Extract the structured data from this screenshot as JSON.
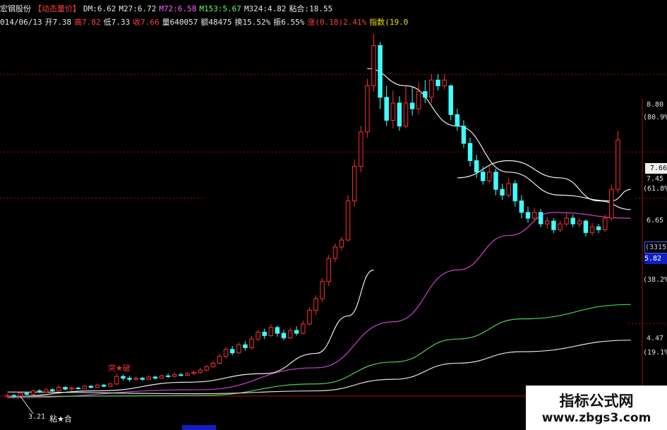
{
  "header": {
    "row1": [
      {
        "text": "宏钢股份",
        "cls": "w"
      },
      {
        "text": "【动态量价】",
        "cls": "r"
      },
      {
        "text": "DM:6.62",
        "cls": "w"
      },
      {
        "text": "M27:6.72",
        "cls": "w"
      },
      {
        "text": "M72:6.58",
        "cls": "m"
      },
      {
        "text": "M153:5.67",
        "cls": "g"
      },
      {
        "text": "M324:4.82",
        "cls": "w"
      },
      {
        "text": "粘合:18.55",
        "cls": "w"
      }
    ],
    "row2": [
      {
        "text": "014/06/13",
        "cls": "w"
      },
      {
        "text": "开7.38",
        "cls": "w"
      },
      {
        "text": "高7.82",
        "cls": "r"
      },
      {
        "text": "低7.33",
        "cls": "w"
      },
      {
        "text": "收7.66",
        "cls": "r"
      },
      {
        "text": "量640057",
        "cls": "w"
      },
      {
        "text": "额48475",
        "cls": "w"
      },
      {
        "text": "换15.52%",
        "cls": "w"
      },
      {
        "text": "振6.55%",
        "cls": "w"
      },
      {
        "text": "涨(0.18)2.41%",
        "cls": "r"
      },
      {
        "text": "指数(19.0",
        "cls": "y"
      }
    ]
  },
  "right_axis": {
    "p_top": "8.80",
    "p_top_pct": "(80.9%)",
    "price_box": "7.66",
    "p_745": "7.45",
    "p_745_pct": "(61.8%)",
    "p_665": "6.65",
    "count_box": "(3315)",
    "low_box": "5.82",
    "p_38": "(38.2%)",
    "p_447": "4.47",
    "p_19": "(19.1%)"
  },
  "annotations": {
    "breakout": "突★破",
    "stick": "粘★合",
    "low": "3.21"
  },
  "watermark": {
    "title": "指标公式网",
    "url": "www.zbgs3.com"
  },
  "colors": {
    "up": "#ff3030",
    "down": "#40ffff",
    "ma_dm": "#f0f0f0",
    "ma_m27": "#f0f0f0",
    "ma_m72": "#d040d0",
    "ma_m153": "#50d050",
    "ma_m324": "#e0e0e0"
  },
  "chart_data": {
    "type": "candlestick",
    "ylim": [
      3.0,
      9.6
    ],
    "candles": [
      [
        3.2,
        3.22,
        3.25,
        3.18
      ],
      [
        3.22,
        3.21,
        3.24,
        3.18
      ],
      [
        3.21,
        3.26,
        3.28,
        3.2
      ],
      [
        3.26,
        3.24,
        3.28,
        3.22
      ],
      [
        3.24,
        3.3,
        3.32,
        3.22
      ],
      [
        3.3,
        3.28,
        3.33,
        3.26
      ],
      [
        3.28,
        3.32,
        3.35,
        3.27
      ],
      [
        3.32,
        3.3,
        3.34,
        3.28
      ],
      [
        3.3,
        3.36,
        3.4,
        3.29
      ],
      [
        3.36,
        3.33,
        3.38,
        3.31
      ],
      [
        3.33,
        3.35,
        3.37,
        3.3
      ],
      [
        3.35,
        3.34,
        3.37,
        3.32
      ],
      [
        3.34,
        3.38,
        3.4,
        3.33
      ],
      [
        3.38,
        3.36,
        3.4,
        3.34
      ],
      [
        3.36,
        3.4,
        3.42,
        3.35
      ],
      [
        3.4,
        3.38,
        3.42,
        3.36
      ],
      [
        3.38,
        3.42,
        3.44,
        3.37
      ],
      [
        3.42,
        3.55,
        3.6,
        3.4
      ],
      [
        3.55,
        3.52,
        3.58,
        3.48
      ],
      [
        3.52,
        3.5,
        3.56,
        3.46
      ],
      [
        3.5,
        3.52,
        3.55,
        3.48
      ],
      [
        3.52,
        3.5,
        3.54,
        3.47
      ],
      [
        3.5,
        3.54,
        3.57,
        3.49
      ],
      [
        3.54,
        3.52,
        3.56,
        3.5
      ],
      [
        3.52,
        3.56,
        3.58,
        3.51
      ],
      [
        3.56,
        3.55,
        3.6,
        3.52
      ],
      [
        3.55,
        3.58,
        3.62,
        3.54
      ],
      [
        3.58,
        3.57,
        3.61,
        3.55
      ],
      [
        3.57,
        3.6,
        3.63,
        3.56
      ],
      [
        3.6,
        3.62,
        3.66,
        3.58
      ],
      [
        3.62,
        3.66,
        3.7,
        3.6
      ],
      [
        3.66,
        3.72,
        3.75,
        3.64
      ],
      [
        3.72,
        3.78,
        3.82,
        3.7
      ],
      [
        3.78,
        3.9,
        3.95,
        3.76
      ],
      [
        3.9,
        4.02,
        4.06,
        3.86
      ],
      [
        4.02,
        3.96,
        4.08,
        3.92
      ],
      [
        3.96,
        4.1,
        4.14,
        3.94
      ],
      [
        4.1,
        4.05,
        4.16,
        4.0
      ],
      [
        4.05,
        4.2,
        4.25,
        4.02
      ],
      [
        4.2,
        4.32,
        4.36,
        4.16
      ],
      [
        4.32,
        4.26,
        4.38,
        4.2
      ],
      [
        4.26,
        4.4,
        4.46,
        4.24
      ],
      [
        4.4,
        4.3,
        4.44,
        4.24
      ],
      [
        4.3,
        4.22,
        4.36,
        4.18
      ],
      [
        4.22,
        4.35,
        4.4,
        4.2
      ],
      [
        4.35,
        4.3,
        4.42,
        4.26
      ],
      [
        4.3,
        4.46,
        4.52,
        4.28
      ],
      [
        4.46,
        4.7,
        4.75,
        4.44
      ],
      [
        4.7,
        4.9,
        4.96,
        4.62
      ],
      [
        4.9,
        5.2,
        5.26,
        4.84
      ],
      [
        5.2,
        5.6,
        5.66,
        5.12
      ],
      [
        5.6,
        5.8,
        5.86,
        5.54
      ],
      [
        5.8,
        5.92,
        5.98,
        5.74
      ],
      [
        5.92,
        6.6,
        6.7,
        5.9
      ],
      [
        6.6,
        7.2,
        7.32,
        6.5
      ],
      [
        7.2,
        7.8,
        7.9,
        7.1
      ],
      [
        7.8,
        8.6,
        8.72,
        7.7
      ],
      [
        8.6,
        9.3,
        9.5,
        8.5
      ],
      [
        9.3,
        8.4,
        9.36,
        8.2
      ],
      [
        8.4,
        8.0,
        8.6,
        7.9
      ],
      [
        8.0,
        8.3,
        8.52,
        7.86
      ],
      [
        8.3,
        7.9,
        8.42,
        7.82
      ],
      [
        7.9,
        8.3,
        8.62,
        7.86
      ],
      [
        8.3,
        8.2,
        8.58,
        8.08
      ],
      [
        8.2,
        8.5,
        8.66,
        8.1
      ],
      [
        8.5,
        8.4,
        8.7,
        8.3
      ],
      [
        8.4,
        8.7,
        8.8,
        8.3
      ],
      [
        8.7,
        8.6,
        8.8,
        8.52
      ],
      [
        8.6,
        8.7,
        8.8,
        8.54
      ],
      [
        8.6,
        8.1,
        8.62,
        8.0
      ],
      [
        8.1,
        7.9,
        8.2,
        7.82
      ],
      [
        7.9,
        7.6,
        8.0,
        7.52
      ],
      [
        7.6,
        7.3,
        7.7,
        7.2
      ],
      [
        7.3,
        7.1,
        7.4,
        7.0
      ],
      [
        7.1,
        6.95,
        7.2,
        6.88
      ],
      [
        6.95,
        7.1,
        7.2,
        6.9
      ],
      [
        7.1,
        6.8,
        7.16,
        6.7
      ],
      [
        6.8,
        6.7,
        6.9,
        6.62
      ],
      [
        6.7,
        6.9,
        7.0,
        6.66
      ],
      [
        6.9,
        6.6,
        6.96,
        6.5
      ],
      [
        6.6,
        6.4,
        6.7,
        6.3
      ],
      [
        6.4,
        6.3,
        6.5,
        6.22
      ],
      [
        6.3,
        6.4,
        6.48,
        6.24
      ],
      [
        6.4,
        6.2,
        6.46,
        6.14
      ],
      [
        6.2,
        6.25,
        6.32,
        6.12
      ],
      [
        6.25,
        6.1,
        6.3,
        6.04
      ],
      [
        6.1,
        6.2,
        6.26,
        6.06
      ],
      [
        6.2,
        6.3,
        6.38,
        6.16
      ],
      [
        6.3,
        6.2,
        6.36,
        6.14
      ],
      [
        6.2,
        6.25,
        6.3,
        6.14
      ],
      [
        6.25,
        6.05,
        6.28,
        5.98
      ],
      [
        6.05,
        6.15,
        6.22,
        6.0
      ],
      [
        6.15,
        6.1,
        6.2,
        6.04
      ],
      [
        6.1,
        6.3,
        6.36,
        6.06
      ],
      [
        6.3,
        6.8,
        6.88,
        6.26
      ],
      [
        6.8,
        7.66,
        7.82,
        6.74
      ]
    ],
    "moving_averages": [
      {
        "name": "DM",
        "points": [
          [
            0,
            3.2
          ],
          [
            14,
            3.3
          ],
          [
            28,
            3.45
          ],
          [
            40,
            3.6
          ],
          [
            48,
            3.95
          ],
          [
            53,
            4.6
          ],
          [
            57,
            5.4
          ]
        ]
      },
      {
        "name": "M27",
        "points": [
          [
            56,
            8.9
          ],
          [
            62,
            8.6
          ],
          [
            70,
            7.9
          ],
          [
            78,
            7.1
          ],
          [
            86,
            6.7
          ],
          [
            94,
            6.6
          ],
          [
            97,
            6.8
          ]
        ]
      },
      {
        "name": "M72",
        "points": [
          [
            0,
            3.18
          ],
          [
            30,
            3.32
          ],
          [
            48,
            3.7
          ],
          [
            60,
            4.5
          ],
          [
            70,
            5.4
          ],
          [
            78,
            6.0
          ],
          [
            85,
            6.4
          ],
          [
            97,
            6.3
          ]
        ]
      },
      {
        "name": "M153",
        "points": [
          [
            0,
            3.2
          ],
          [
            30,
            3.22
          ],
          [
            48,
            3.42
          ],
          [
            60,
            3.8
          ],
          [
            70,
            4.2
          ],
          [
            80,
            4.55
          ],
          [
            97,
            4.8
          ]
        ]
      },
      {
        "name": "M324",
        "points": [
          [
            0,
            3.28
          ],
          [
            30,
            3.25
          ],
          [
            48,
            3.3
          ],
          [
            60,
            3.5
          ],
          [
            70,
            3.78
          ],
          [
            80,
            3.98
          ],
          [
            97,
            4.18
          ]
        ]
      },
      {
        "name": "M27b",
        "points": [
          [
            70,
            7.0
          ],
          [
            78,
            7.3
          ],
          [
            86,
            7.0
          ],
          [
            92,
            6.6
          ],
          [
            97,
            6.45
          ]
        ]
      }
    ]
  }
}
